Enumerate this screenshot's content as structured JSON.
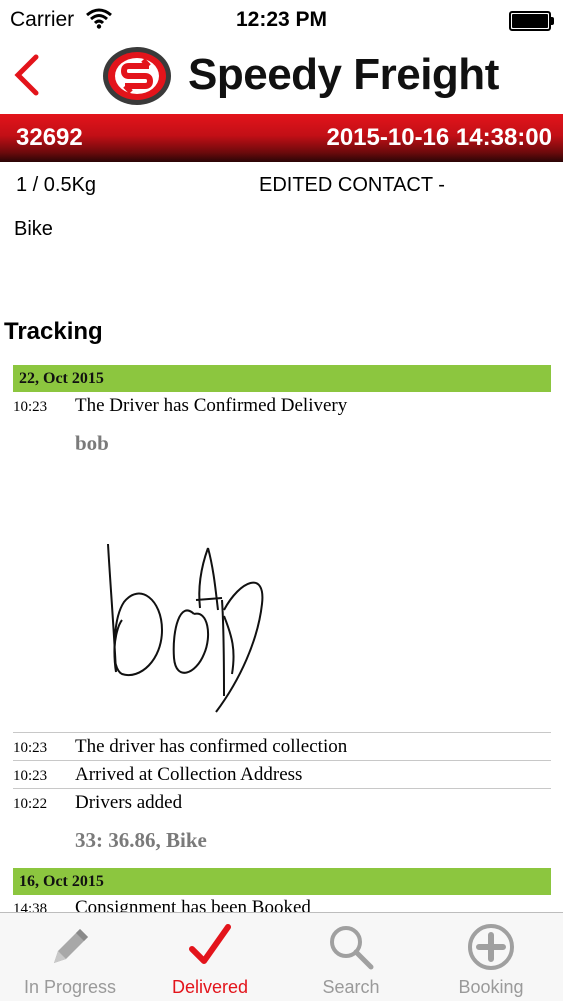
{
  "status_bar": {
    "carrier": "Carrier",
    "time": "12:23 PM"
  },
  "header": {
    "brand": "Speedy Freight",
    "back_icon": "chevron-left-icon",
    "logo_icon": "speedy-s-logo-icon"
  },
  "job": {
    "number": "32692",
    "datetime": "2015-10-16 14:38:00",
    "weight": "1 / 0.5Kg",
    "contact": "EDITED CONTACT -",
    "vehicle": "Bike"
  },
  "tracking": {
    "title": "Tracking",
    "days": [
      {
        "date": "22, Oct 2015",
        "events": [
          {
            "time": "10:23",
            "desc": "The Driver has Confirmed Delivery",
            "note": "bob"
          },
          {
            "time": "10:23",
            "desc": "The driver has confirmed collection"
          },
          {
            "time": "10:23",
            "desc": "Arrived at Collection Address"
          },
          {
            "time": "10:22",
            "desc": "Drivers added",
            "note": "33: 36.86, Bike"
          }
        ]
      },
      {
        "date": "16, Oct 2015",
        "events": [
          {
            "time": "14:38",
            "desc": "Consignment has been Booked"
          }
        ]
      }
    ]
  },
  "tabs": [
    {
      "label": "In Progress",
      "icon": "pencil-icon",
      "active": false
    },
    {
      "label": "Delivered",
      "icon": "checkmark-icon",
      "active": true
    },
    {
      "label": "Search",
      "icon": "search-icon",
      "active": false
    },
    {
      "label": "Booking",
      "icon": "add-circle-icon",
      "active": false
    }
  ],
  "colors": {
    "brand_red": "#e3141b",
    "day_green": "#8cc63f",
    "tab_inactive": "#9a9a9a"
  }
}
